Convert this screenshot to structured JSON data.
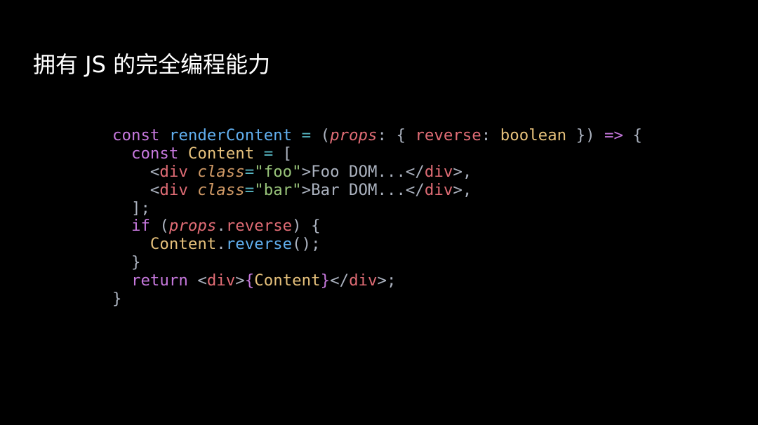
{
  "slide": {
    "title": "拥有 JS 的完全编程能力"
  },
  "code": {
    "colors": {
      "kw": "#c678dd",
      "fn": "#61afef",
      "var": "#e06c75",
      "ty": "#e5c07b",
      "str": "#98c379",
      "attr": "#d19a66",
      "op": "#56b6c2",
      "pl": "#abb2bf"
    },
    "lines": [
      [
        [
          "const",
          "kw"
        ],
        [
          " ",
          "pl"
        ],
        [
          "renderContent",
          "fn"
        ],
        [
          " ",
          "pl"
        ],
        [
          "=",
          "op"
        ],
        [
          " (",
          "pl"
        ],
        [
          "props",
          "var it"
        ],
        [
          ": { ",
          "pl"
        ],
        [
          "reverse",
          "var"
        ],
        [
          ": ",
          "pl"
        ],
        [
          "boolean",
          "ty"
        ],
        [
          " }) ",
          "pl"
        ],
        [
          "=>",
          "kw"
        ],
        [
          " {",
          "pl"
        ]
      ],
      [
        [
          "  ",
          "pl"
        ],
        [
          "const",
          "kw"
        ],
        [
          " ",
          "pl"
        ],
        [
          "Content",
          "ty"
        ],
        [
          " ",
          "pl"
        ],
        [
          "=",
          "op"
        ],
        [
          " [",
          "pl"
        ]
      ],
      [
        [
          "    <",
          "pl"
        ],
        [
          "div",
          "var"
        ],
        [
          " ",
          "pl"
        ],
        [
          "class",
          "attr"
        ],
        [
          "=",
          "op"
        ],
        [
          "\"foo\"",
          "str"
        ],
        [
          ">Foo DOM...</",
          "pl"
        ],
        [
          "div",
          "var"
        ],
        [
          ">,",
          "pl"
        ]
      ],
      [
        [
          "    <",
          "pl"
        ],
        [
          "div",
          "var"
        ],
        [
          " ",
          "pl"
        ],
        [
          "class",
          "attr"
        ],
        [
          "=",
          "op"
        ],
        [
          "\"bar\"",
          "str"
        ],
        [
          ">Bar DOM...</",
          "pl"
        ],
        [
          "div",
          "var"
        ],
        [
          ">,",
          "pl"
        ]
      ],
      [
        [
          "  ];",
          "pl"
        ]
      ],
      [
        [
          "  ",
          "pl"
        ],
        [
          "if",
          "kw"
        ],
        [
          " (",
          "pl"
        ],
        [
          "props",
          "var it"
        ],
        [
          ".",
          "pl"
        ],
        [
          "reverse",
          "var"
        ],
        [
          ") {",
          "pl"
        ]
      ],
      [
        [
          "    ",
          "pl"
        ],
        [
          "Content",
          "ty"
        ],
        [
          ".",
          "pl"
        ],
        [
          "reverse",
          "fn"
        ],
        [
          "();",
          "pl"
        ]
      ],
      [
        [
          "  }",
          "pl"
        ]
      ],
      [
        [
          "  ",
          "pl"
        ],
        [
          "return",
          "kw"
        ],
        [
          " <",
          "pl"
        ],
        [
          "div",
          "var"
        ],
        [
          ">",
          "pl"
        ],
        [
          "{",
          "kw"
        ],
        [
          "Content",
          "ty"
        ],
        [
          "}",
          "kw"
        ],
        [
          "</",
          "pl"
        ],
        [
          "div",
          "var"
        ],
        [
          ">;",
          "pl"
        ]
      ],
      [
        [
          "}",
          "pl"
        ]
      ]
    ]
  }
}
